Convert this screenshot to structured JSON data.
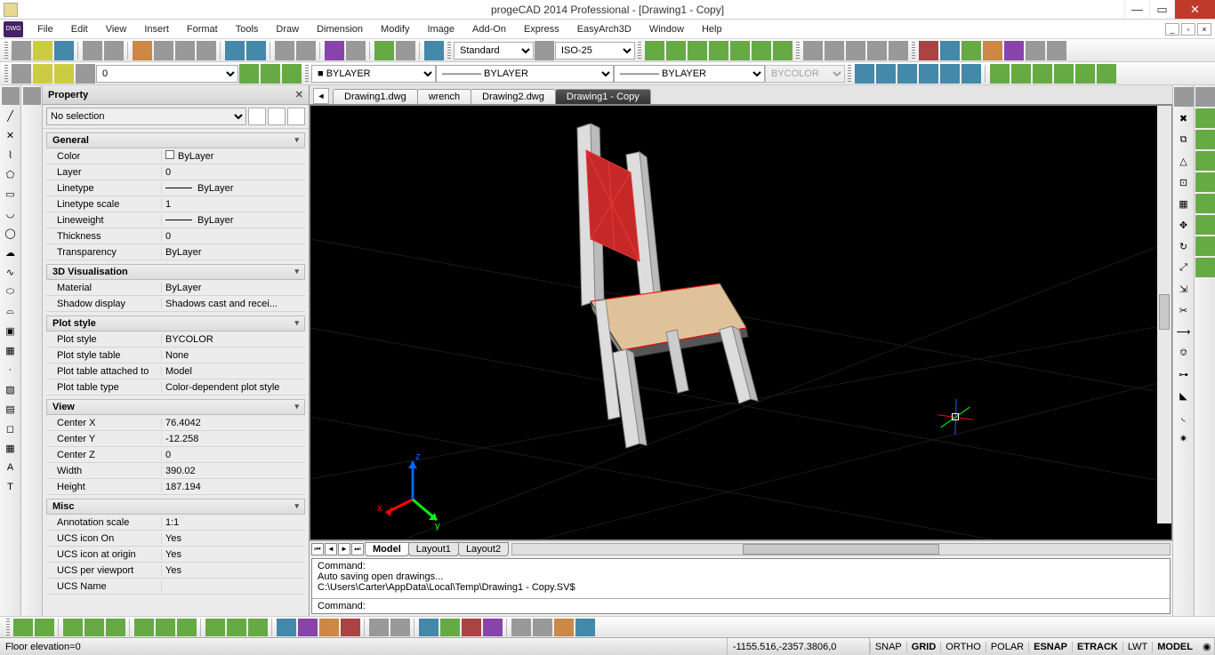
{
  "title": "progeCAD 2014 Professional - [Drawing1 - Copy]",
  "appicon_text": "DWG",
  "menu": [
    "File",
    "Edit",
    "View",
    "Insert",
    "Format",
    "Tools",
    "Draw",
    "Dimension",
    "Modify",
    "Image",
    "Add-On",
    "Express",
    "EasyArch3D",
    "Window",
    "Help"
  ],
  "top_selects": {
    "textstyle": "Standard",
    "dimstyle": "ISO-25"
  },
  "prop_bar": {
    "color": "BYLAYER",
    "linetype": "BYLAYER",
    "lineweight": "BYLAYER",
    "plotstyle": "BYCOLOR"
  },
  "layer_combo": "0",
  "doctabs": [
    {
      "label": "Drawing1.dwg",
      "active": false
    },
    {
      "label": "wrench",
      "active": false
    },
    {
      "label": "Drawing2.dwg",
      "active": false
    },
    {
      "label": "Drawing1 - Copy",
      "active": true
    }
  ],
  "layouttabs": [
    {
      "label": "Model",
      "active": true
    },
    {
      "label": "Layout1",
      "active": false
    },
    {
      "label": "Layout2",
      "active": false
    }
  ],
  "panel": {
    "title": "Property",
    "selection": "No selection",
    "groups": [
      {
        "name": "General",
        "rows": [
          {
            "k": "Color",
            "v": "ByLayer",
            "swatch": true
          },
          {
            "k": "Layer",
            "v": "0"
          },
          {
            "k": "Linetype",
            "v": "ByLayer",
            "line": true
          },
          {
            "k": "Linetype scale",
            "v": "1"
          },
          {
            "k": "Lineweight",
            "v": "ByLayer",
            "line": true
          },
          {
            "k": "Thickness",
            "v": "0"
          },
          {
            "k": "Transparency",
            "v": "ByLayer"
          }
        ]
      },
      {
        "name": "3D Visualisation",
        "rows": [
          {
            "k": "Material",
            "v": "ByLayer"
          },
          {
            "k": "Shadow display",
            "v": "Shadows cast and recei..."
          }
        ]
      },
      {
        "name": "Plot style",
        "rows": [
          {
            "k": "Plot style",
            "v": "BYCOLOR"
          },
          {
            "k": "Plot style table",
            "v": "None"
          },
          {
            "k": "Plot table attached to",
            "v": "Model"
          },
          {
            "k": "Plot table type",
            "v": "Color-dependent plot style"
          }
        ]
      },
      {
        "name": "View",
        "rows": [
          {
            "k": "Center X",
            "v": "76.4042"
          },
          {
            "k": "Center Y",
            "v": "-12.258"
          },
          {
            "k": "Center Z",
            "v": "0"
          },
          {
            "k": "Width",
            "v": "390.02"
          },
          {
            "k": "Height",
            "v": "187.194"
          }
        ]
      },
      {
        "name": "Misc",
        "rows": [
          {
            "k": "Annotation scale",
            "v": "1:1"
          },
          {
            "k": "UCS icon On",
            "v": "Yes"
          },
          {
            "k": "UCS icon at origin",
            "v": "Yes"
          },
          {
            "k": "UCS per viewport",
            "v": "Yes"
          },
          {
            "k": "UCS Name",
            "v": ""
          }
        ]
      }
    ]
  },
  "command": {
    "history": [
      "Command:",
      "Auto saving open drawings...",
      "C:\\Users\\Carter\\AppData\\Local\\Temp\\Drawing1 - Copy.SV$"
    ],
    "prompt": "Command:"
  },
  "status": {
    "left": "Floor elevation=0",
    "coords": "-1155.516,-2357.3806,0",
    "toggles": [
      {
        "t": "SNAP",
        "on": false
      },
      {
        "t": "GRID",
        "on": true
      },
      {
        "t": "ORTHO",
        "on": false
      },
      {
        "t": "POLAR",
        "on": false
      },
      {
        "t": "ESNAP",
        "on": true
      },
      {
        "t": "ETRACK",
        "on": true
      },
      {
        "t": "LWT",
        "on": false
      },
      {
        "t": "MODEL",
        "on": true
      }
    ]
  },
  "axis": {
    "x": "x",
    "y": "y",
    "z": "z"
  }
}
